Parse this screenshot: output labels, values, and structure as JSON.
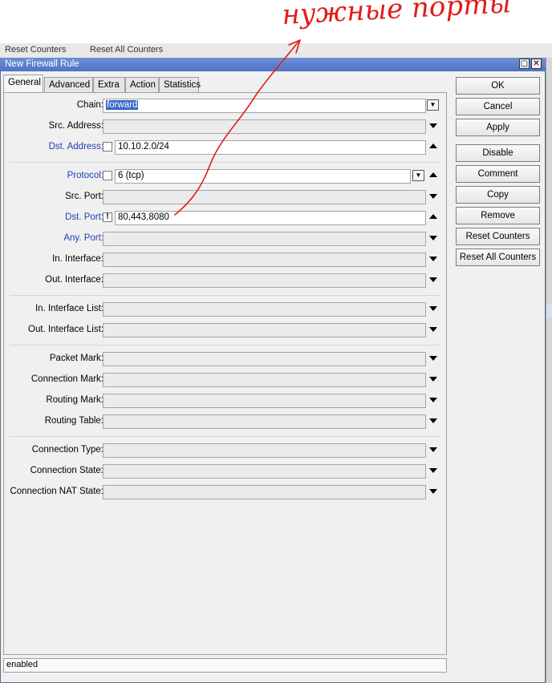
{
  "background_toolbar": {
    "items": [
      "Reset Counters",
      "Reset All Counters"
    ]
  },
  "window": {
    "title": "New Firewall Rule"
  },
  "tabs": [
    "General",
    "Advanced",
    "Extra",
    "Action",
    "Statistics"
  ],
  "fields": {
    "chain": {
      "label": "Chain:",
      "value": "forward"
    },
    "src_address": {
      "label": "Src. Address:",
      "value": ""
    },
    "dst_address": {
      "label": "Dst. Address:",
      "value": "10.10.2.0/24"
    },
    "protocol": {
      "label": "Protocol:",
      "value": "6 (tcp)"
    },
    "src_port": {
      "label": "Src. Port:",
      "value": ""
    },
    "dst_port": {
      "label": "Dst. Port:",
      "value": "80,443,8080",
      "negate": "!"
    },
    "any_port": {
      "label": "Any. Port:",
      "value": ""
    },
    "in_interface": {
      "label": "In. Interface:",
      "value": ""
    },
    "out_interface": {
      "label": "Out. Interface:",
      "value": ""
    },
    "in_interface_list": {
      "label": "In. Interface List:",
      "value": ""
    },
    "out_interface_list": {
      "label": "Out. Interface List:",
      "value": ""
    },
    "packet_mark": {
      "label": "Packet Mark:",
      "value": ""
    },
    "connection_mark": {
      "label": "Connection Mark:",
      "value": ""
    },
    "routing_mark": {
      "label": "Routing Mark:",
      "value": ""
    },
    "routing_table": {
      "label": "Routing Table:",
      "value": ""
    },
    "connection_type": {
      "label": "Connection Type:",
      "value": ""
    },
    "connection_state": {
      "label": "Connection State:",
      "value": ""
    },
    "connection_nat_state": {
      "label": "Connection NAT State:",
      "value": ""
    }
  },
  "buttons": [
    "OK",
    "Cancel",
    "Apply",
    "Disable",
    "Comment",
    "Copy",
    "Remove",
    "Reset Counters",
    "Reset All Counters"
  ],
  "status": "enabled",
  "annotation": {
    "text": "нужные порты",
    "color": "#e11b1b"
  }
}
